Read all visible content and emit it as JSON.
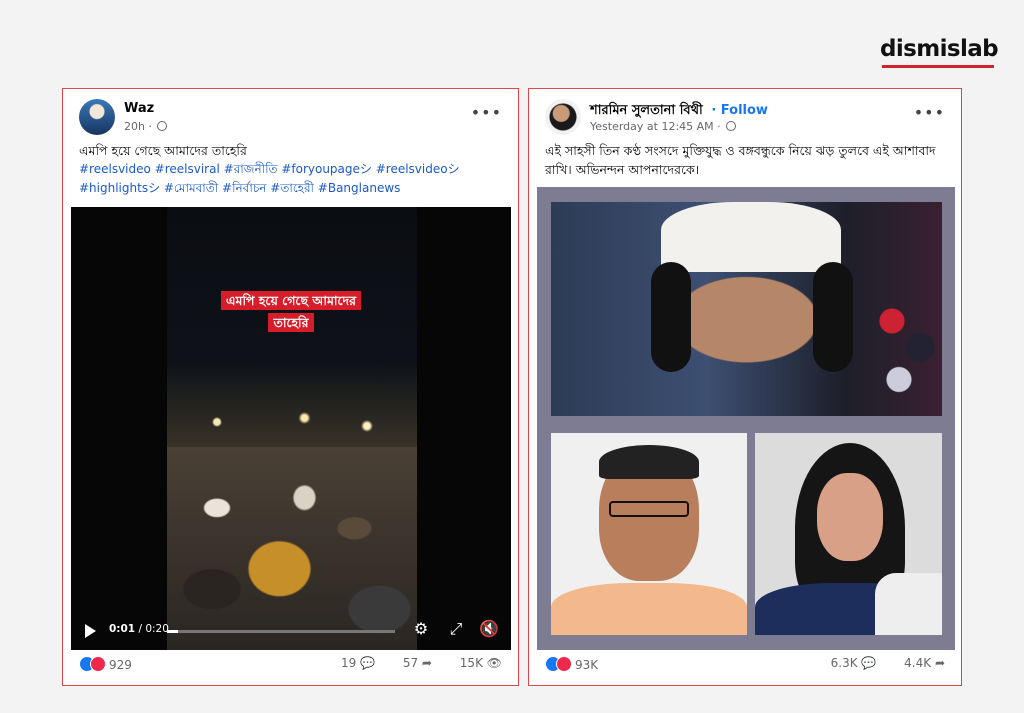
{
  "brand": {
    "name": "dismislab",
    "accent": "#d2232a"
  },
  "left_post": {
    "author": "Waz",
    "time": "20h ·",
    "caption": "এমপি হয়ে গেছে আমাদের তাহেরি",
    "hashtags": "#reelsvideo #reelsviral #রাজনীতি #foryoupageシ #reelsvideoシ #highlightsシ #মোমবাতী #নির্বাচন #তাহেরী #Banglanews",
    "video_overlay_line1": "এমপি হয়ে গেছে আমাদের",
    "video_overlay_line2": "তাহেরি",
    "video_time_current": "0:01",
    "video_time_total": "/ 0:20",
    "video_progress": 0.05,
    "reactions": "929",
    "comments": "19",
    "shares": "57",
    "views": "15K"
  },
  "right_post": {
    "author": "শারমিন সুলতানা বিথী",
    "follow_label": "· Follow",
    "time": "Yesterday at 12:45 AM ·",
    "caption": "এই সাহসী তিন কণ্ঠ সংসদে মুক্তিযুদ্ধ ও বঙ্গবন্ধুকে নিয়ে ঝড় তুলবে এই আশাবাদ রাখি। অভিনন্দন আপনাদেরকে।",
    "reactions": "93K",
    "comments": "6.3K",
    "shares": "4.4K"
  },
  "colors": {
    "link": "#1a5ac8",
    "follow": "#1877f2",
    "frame": "#e0474c",
    "overlay": "#d81d2a"
  }
}
